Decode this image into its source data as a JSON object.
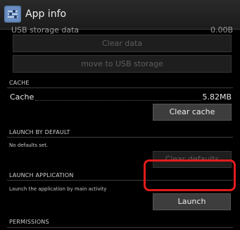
{
  "action_bar": {
    "title": "App info",
    "icon": "app-settings-icon"
  },
  "storage": {
    "cut_label": "USB storage data",
    "cut_value": "0.00B",
    "clear_data_label": "Clear data",
    "move_label": "move to USB storage"
  },
  "cache": {
    "header": "CACHE",
    "label": "Cache",
    "value": "5.82MB",
    "clear_label": "Clear cache"
  },
  "launch_default": {
    "header": "LAUNCH BY DEFAULT",
    "text": "No defaults set.",
    "clear_label": "Clear defaults"
  },
  "launch_app": {
    "header": "LAUNCH APPLICATION",
    "text": "Launch the application by main activity",
    "button_label": "Launch"
  },
  "permissions": {
    "header": "PERMISSIONS"
  },
  "colors": {
    "highlight": "#e31b1b",
    "background": "#000000"
  }
}
